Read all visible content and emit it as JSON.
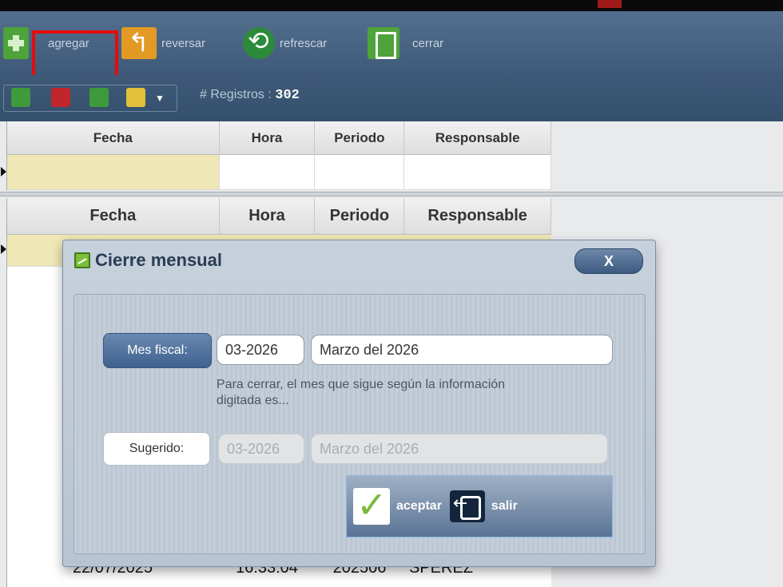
{
  "toolbar": {
    "agregar": "agregar",
    "reversar": "reversar",
    "refrescar": "refrescar",
    "cerrar": "cerrar"
  },
  "subbar": {
    "registros_label": "# Registros :",
    "registros_count": "302"
  },
  "grid_top": {
    "headers": [
      "Fecha",
      "Hora",
      "Periodo",
      "Responsable"
    ]
  },
  "grid_main": {
    "headers": [
      "Fecha",
      "Hora",
      "Periodo",
      "Responsable"
    ],
    "bottom_row": [
      "22/07/2025",
      "16:33:04",
      "202506",
      "SPEREZ"
    ]
  },
  "dialog": {
    "title": "Cierre mensual",
    "close": "X",
    "mes_label": "Mes fiscal:",
    "mes_value": "03-2026",
    "mes_text": "Marzo del 2026",
    "hint": "Para cerrar, el mes que sigue según la información digitada es...",
    "sug_label": "Sugerido:",
    "sug_value": "03-2026",
    "sug_text": "Marzo del 2026",
    "aceptar": "aceptar",
    "salir": "salir"
  },
  "colors": {
    "highlight": "#e50c0c",
    "toolbar": "#4a6584",
    "row_selected": "#efe7b6"
  }
}
